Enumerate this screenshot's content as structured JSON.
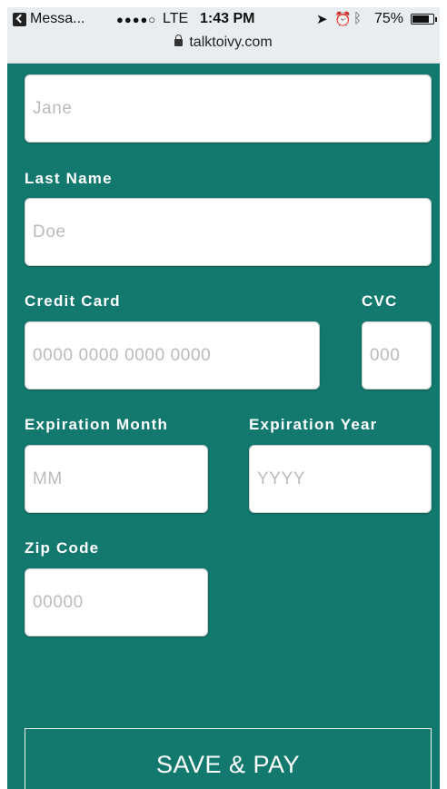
{
  "status_bar": {
    "back_app": "Messa...",
    "signal": "●●●●○",
    "network": "LTE",
    "time": "1:43 PM",
    "location_icon": "location-arrow-icon",
    "alarm_icon": "alarm-icon",
    "bluetooth_icon": "bluetooth-icon",
    "battery_percent": "75%",
    "battery_level": 0.75
  },
  "browser": {
    "url": "talktoivy.com"
  },
  "form": {
    "first_name": {
      "placeholder": "Jane"
    },
    "last_name": {
      "label": "Last Name",
      "placeholder": "Doe"
    },
    "credit_card": {
      "label": "Credit Card",
      "placeholder": "0000 0000 0000 0000"
    },
    "cvc": {
      "label": "CVC",
      "placeholder": "000"
    },
    "exp_month": {
      "label": "Expiration Month",
      "placeholder": "MM"
    },
    "exp_year": {
      "label": "Expiration Year",
      "placeholder": "YYYY"
    },
    "zip": {
      "label": "Zip Code",
      "placeholder": "00000"
    },
    "submit_label": "SAVE & PAY"
  },
  "colors": {
    "form_background": "#13796e",
    "status_background": "#e9edf0",
    "button_border": "#ffffff"
  }
}
